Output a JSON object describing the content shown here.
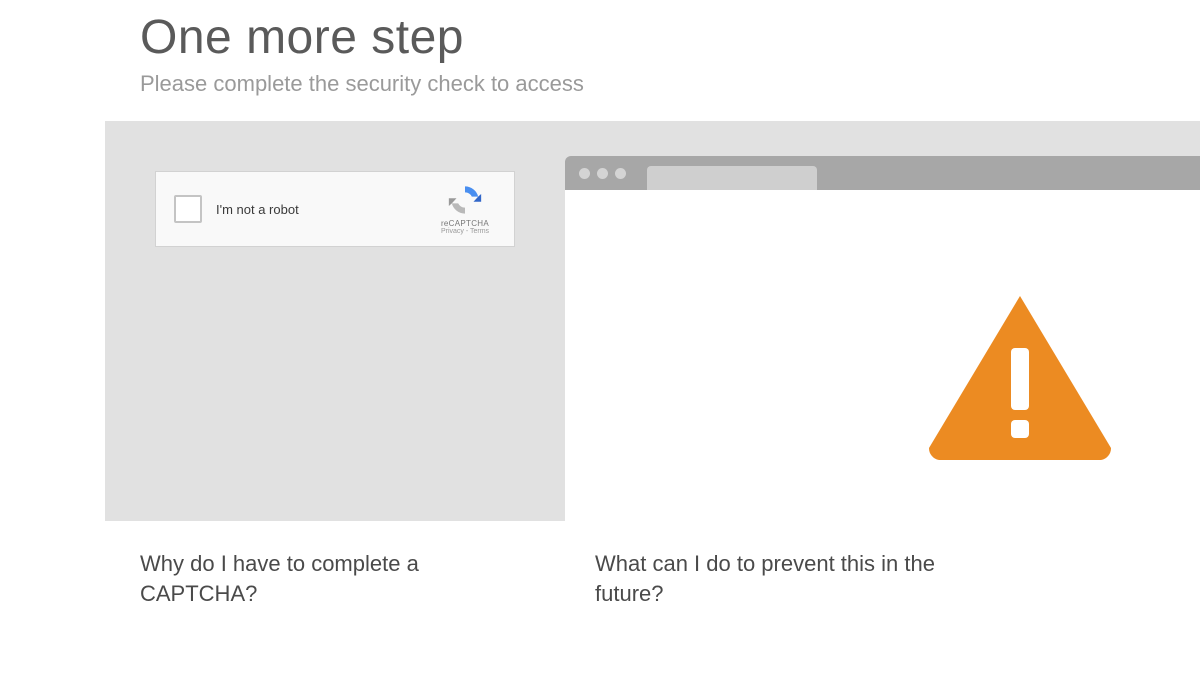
{
  "header": {
    "title": "One more step",
    "subtitle": "Please complete the security check to access"
  },
  "captcha": {
    "label": "I'm not a robot",
    "brand": "reCAPTCHA",
    "legal": "Privacy - Terms"
  },
  "icons": {
    "warning": "warning-triangle-icon",
    "recaptcha": "recaptcha-icon"
  },
  "colors": {
    "warning": "#ec8b22",
    "stage": "#e1e1e1",
    "titlebar": "#a7a7a7"
  },
  "questions": {
    "left": "Why do I have to complete a CAPTCHA?",
    "right": "What can I do to prevent this in the future?"
  }
}
